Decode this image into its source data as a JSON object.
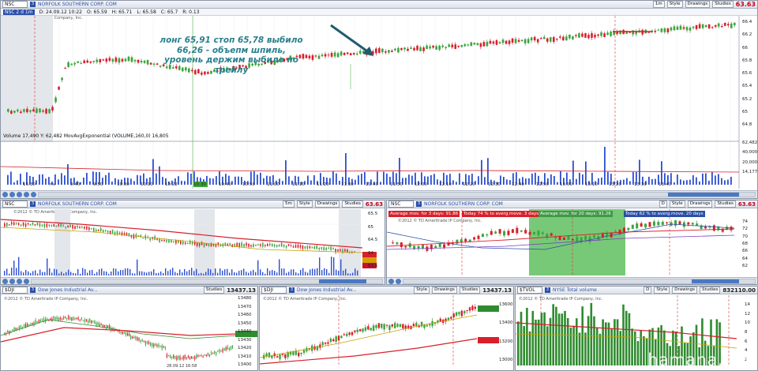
{
  "main": {
    "symbol": "NSC",
    "link_num": "3",
    "company": "NORFOLK SOUTHERN CORP. COM",
    "last_price": "63.63",
    "ohlc": {
      "sym_tf": "NSC 2 d 1m",
      "date": "D: 24.09.12 10:22",
      "open": "O: 65.59",
      "high": "H: 65.71",
      "low": "L: 65.58",
      "close": "C: 65.7",
      "range": "R: 0.13"
    },
    "copyright": "©2012 TD Ameritrade IP Company, Inc.",
    "annotation": "лонг 65,91 стоп 65,78 выбило 66,26 - объепм шпиль, уровень держим выбило по трейлу",
    "y_ticks": [
      "66.4",
      "66.2",
      "66",
      "65.8",
      "65.6",
      "65.4",
      "65.2",
      "65",
      "64.8"
    ],
    "volume_label": "Volume 17,490  Y: 62,482  MovAvgExponential (VOLUME,160,0) 16,805",
    "vol_ticks": [
      "62,482",
      "40,000",
      "20,000",
      "14,177"
    ],
    "time_labels": [
      "16:30",
      "пн",
      "9:40",
      "9:50",
      "10:00",
      "10:10",
      "10:22",
      "10:30",
      "10:40",
      "10:50",
      "11:00",
      "11:10",
      "11:20",
      "11:30",
      "11:40",
      "11:50",
      "12:00",
      "12:10",
      "12:20",
      "12:30",
      "12:40",
      "12:50",
      "13:00",
      "13:10",
      "13:20",
      "13:30",
      "13:40"
    ],
    "toolbar": {
      "tf": "1m",
      "style": "Style",
      "drawings": "Drawings",
      "studies": "Studies"
    }
  },
  "mid_left": {
    "symbol": "NSC",
    "company": "NORFOLK SOUTHERN CORP. COM",
    "last_price": "63.63",
    "tf": "5m",
    "copyright": "©2012 © TD Ameritrade IP Company, Inc.",
    "y_ticks": [
      "65.5",
      "65",
      "64.5",
      "64",
      "63.5"
    ],
    "price_tags": [
      "64.1",
      "63.78",
      "63.63"
    ],
    "toolbar": {
      "style": "Style",
      "drawings": "Drawings",
      "studies": "Studies"
    }
  },
  "mid_right": {
    "symbol": "NSC",
    "company": "NORFOLK SOUTHERN CORP. COM",
    "last_price": "63.63",
    "tf": "D",
    "copyright": "©2012 © TD Ameritrade IP Company, Inc.",
    "bar1": "Average mov. for 3 days: 91.86",
    "bar2": "Today 74 % to averg.move. 3 days",
    "bar3": "Average mov. for 20 days: 91.26",
    "bar4": "Today 62 % to averg.move. 20 days",
    "y_ticks": [
      "74",
      "72",
      "70",
      "68",
      "66",
      "64",
      "62"
    ],
    "toolbar": {
      "style": "Style",
      "drawings": "Drawings",
      "studies": "Studies"
    }
  },
  "bot1": {
    "symbol": "$DJI",
    "company": "Dow Jones Industrial Av...",
    "last_price": "13437.13",
    "copyright": "©2012 © TD Ameritrade IP Company, Inc.",
    "y_ticks": [
      "13480",
      "13470",
      "13460",
      "13450",
      "13440",
      "13430",
      "13420",
      "13410",
      "13400"
    ],
    "price_tag": "13437.13",
    "date_label": "28.09.12 16:58",
    "toolbar": {
      "studies": "Studies"
    }
  },
  "bot2": {
    "symbol": "$DJI",
    "company": "Dow Jones Industrial Av...",
    "last_price": "13437.13",
    "copyright": "©2012 © TD Ameritrade IP Company, Inc.",
    "y_ticks": [
      "13600",
      "13400",
      "13200",
      "13000"
    ],
    "price_tags": [
      "13437.13",
      "13056.03"
    ],
    "toolbar": {
      "style": "Style",
      "drawings": "Drawings",
      "studies": "Studies"
    }
  },
  "bot3": {
    "symbol": "$TVOL",
    "company": "NYSE Total volume",
    "last_price": "832110.00",
    "copyright": "©2012 © TD Ameritrade IP Company, Inc.",
    "y_ticks": [
      "14",
      "12",
      "10",
      "8",
      "6",
      "4",
      "2"
    ],
    "tf": "D",
    "toolbar": {
      "style": "Style",
      "drawings": "Drawings",
      "studies": "Studies"
    }
  },
  "watermark": "hamana.net"
}
